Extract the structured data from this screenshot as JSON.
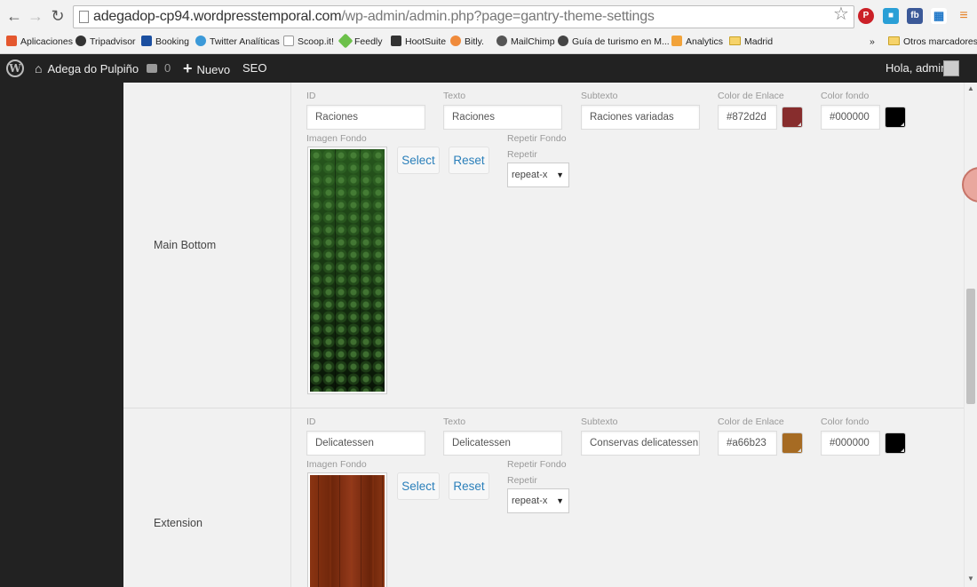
{
  "browser": {
    "url_host": "adegadop-cp94.wordpresstemporal.com",
    "url_path": "/wp-admin/admin.php?page=gantry-theme-settings",
    "bookmarks": [
      {
        "label": "Aplicaciones",
        "color": "#e4572e"
      },
      {
        "label": "Tripadvisor",
        "color": "#333333"
      },
      {
        "label": "Booking",
        "color": "#1b4fa0"
      },
      {
        "label": "Twitter Analíticas",
        "color": "#3b99d8"
      },
      {
        "label": "Scoop.it!",
        "color": "#999999"
      },
      {
        "label": "Feedly",
        "color": "#6cc04a"
      },
      {
        "label": "HootSuite",
        "color": "#333333"
      },
      {
        "label": "Bitly.",
        "color": "#ef8a3b"
      },
      {
        "label": "MailChimp",
        "color": "#555555"
      },
      {
        "label": "Guía de turismo en M...",
        "color": "#444444"
      },
      {
        "label": "Analytics",
        "color": "#f2a33a"
      },
      {
        "label": "Madrid",
        "color": "#f6d36a"
      }
    ],
    "bookmarks_overflow": "»",
    "other_bookmarks": "Otros marcadores"
  },
  "adminbar": {
    "site_name": "Adega do Pulpiño",
    "comments_count": "0",
    "new_label": "Nuevo",
    "seo_label": "SEO",
    "greeting": "Hola, admin"
  },
  "labels": {
    "id": "ID",
    "text": "Texto",
    "subtext": "Subtexto",
    "link_color": "Color de Enlace",
    "bg_color": "Color fondo",
    "bg_image": "Imagen Fondo",
    "repeat_bg": "Repetir Fondo",
    "repeat": "Repetir",
    "select": "Select",
    "reset": "Reset"
  },
  "sections": [
    {
      "name": "Main Bottom",
      "id": "Raciones",
      "text": "Raciones",
      "subtext": "Raciones variadas",
      "link_color": "#872d2d",
      "bg_color": "#000000",
      "repeat": "repeat-x"
    },
    {
      "name": "Extension",
      "id": "Delicatessen",
      "text": "Delicatessen",
      "subtext": "Conservas delicatessen Lu",
      "link_color": "#a66b23",
      "bg_color": "#000000",
      "repeat": "repeat-x"
    }
  ]
}
